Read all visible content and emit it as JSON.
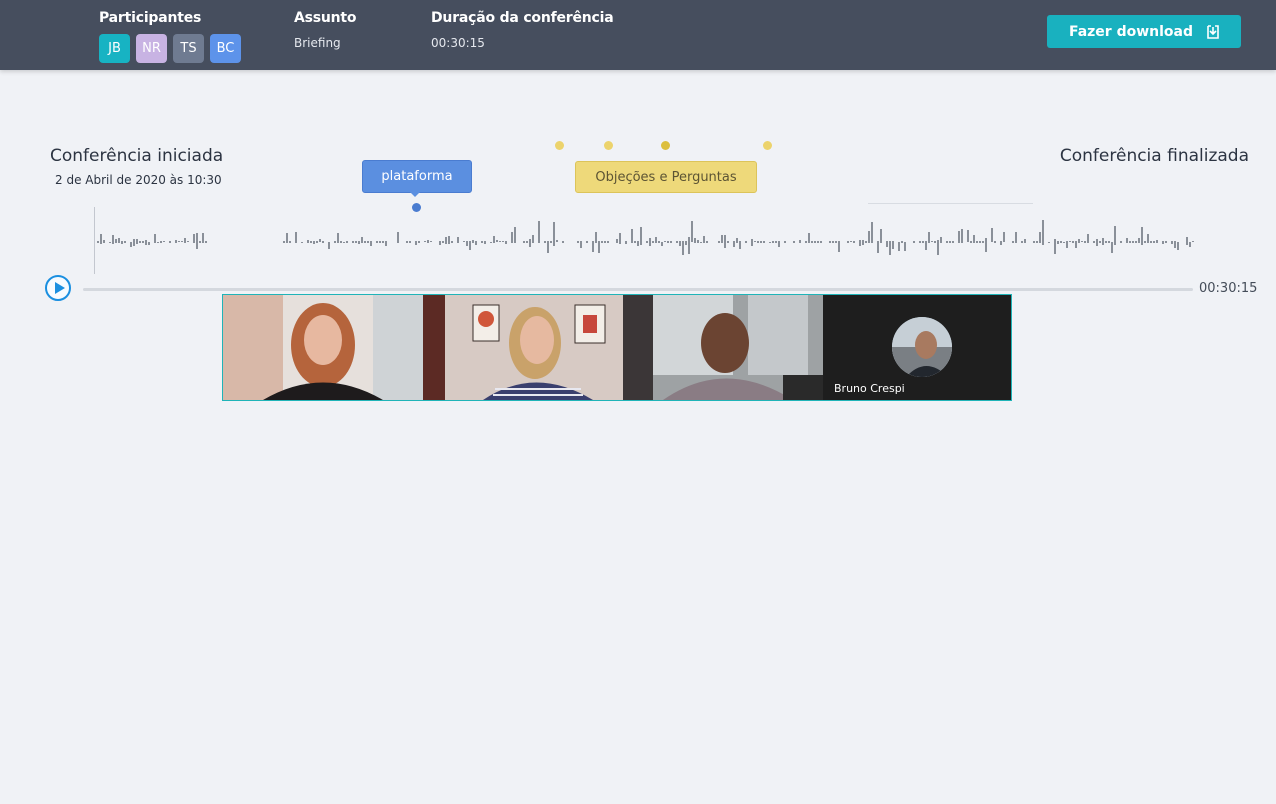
{
  "header": {
    "participants_label": "Participantes",
    "participants": [
      {
        "initials": "JB",
        "color": "#17b3c3"
      },
      {
        "initials": "NR",
        "color": "#c8b3e3"
      },
      {
        "initials": "TS",
        "color": "#6f7b91"
      },
      {
        "initials": "BC",
        "color": "#5d93ea"
      }
    ],
    "subject_label": "Assunto",
    "subject_value": "Briefing",
    "duration_label": "Duração da conferência",
    "duration_value": "00:30:15",
    "download_label": "Fazer download",
    "download_icon": "download-icon"
  },
  "timeline": {
    "start_title": "Conferência iniciada",
    "start_date": "2 de Abril de 2020 às 10:30",
    "end_title": "Conferência finalizada",
    "tag_blue": "plataforma",
    "tag_yellow": "Objeções e Perguntas",
    "total_time": "00:30:15",
    "play_icon": "play-icon"
  },
  "videos": {
    "last_participant_name": "Bruno Crespi"
  }
}
